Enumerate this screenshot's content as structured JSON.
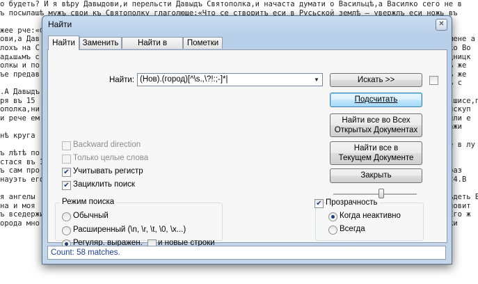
{
  "background_text": [
    "о будеть? И я вѣру Давыдови,и перельсти Давыдъ Святополка,и начаста думати о Васильцѣ,а Василко сего не в",
    "ъ посылашѣ мужъ свои къ Святополку глаголюще:«Что се створитъ еси в Русьской землѣ — увержлъ еси ножь въ",
    "",
    "жее рче:«Ѿ",
    "ови,а Дав",
    "лохъ на С",
    "адѧшѧмъ с",
    "олкы и по",
    "ъе предав",
    "",
    ".А Давыдъ",
    "ря въ 15 ",
    "ополка,ни",
    "и рече ем",
    "",
    "нѣ круга ",
    "",
    "ъ лѣтѣ по",
    "стася въ 12",
    "ъ сам про",
    "науэть его",
    "",
    "я ангелы ",
    "на и моя ",
    "ъ вседержи",
    "орода мно"
  ],
  "background_text_right": [
    "",
    "",
    "",
    "",
    "мене а",
    "ко Во",
    "дницк",
    "ъ же ",
    "ъ же ",
    "ъ с ",
    "",
    "вшисе,по",
    "искуп",
    "или е",
    "ажи ",
    "",
    "е в лу",
    "",
    "",
    "раз",
    "24.В",
    "",
    "ъдеть В",
    "ловит",
    "Его ж",
    "жи"
  ],
  "window": {
    "title": "Найти",
    "close_glyph": "✕"
  },
  "tabs": [
    {
      "label": "Найти",
      "active": true
    },
    {
      "label": "Заменить",
      "active": false
    },
    {
      "label": "Найти в файлах",
      "active": false
    },
    {
      "label": "Пометки",
      "active": false
    }
  ],
  "find": {
    "label": "Найти:",
    "value": "(Нов).(город)[^\\s.,\\?!:;-]*|",
    "dropdown_glyph": "▼"
  },
  "buttons": {
    "find_next": "Искать >>",
    "count": "Подсчитать",
    "find_all_open_line1": "Найти все во Всех",
    "find_all_open_line2": "Открытых Документах",
    "find_all_current_line1": "Найти все в",
    "find_all_current_line2": "Текущем Документе",
    "close": "Закрыть"
  },
  "options": {
    "backward": {
      "label": "Backward direction",
      "checked": false,
      "enabled": false
    },
    "whole_word": {
      "label": "Только целые слова",
      "checked": false,
      "enabled": false
    },
    "match_case": {
      "label": "Учитывать регистр",
      "checked": true,
      "enabled": true
    },
    "wrap_around": {
      "label": "Зациклить поиск",
      "checked": true,
      "enabled": true
    },
    "check_glyph": "✔"
  },
  "search_mode": {
    "title": "Режим поиска",
    "normal": "Обычный",
    "extended": "Расширенный (\\n, \\r, \\t, \\0, \\x...)",
    "regex": "Регуляр. выражен.",
    "newlines": "и новые строки",
    "selected": "regex"
  },
  "transparency": {
    "title": "Прозрачность",
    "checked": true,
    "on_lose_focus": "Когда неактивно",
    "always": "Всегда",
    "selected": "on_lose_focus",
    "level": 0.55
  },
  "status": {
    "text": "Count: 58 matches."
  }
}
